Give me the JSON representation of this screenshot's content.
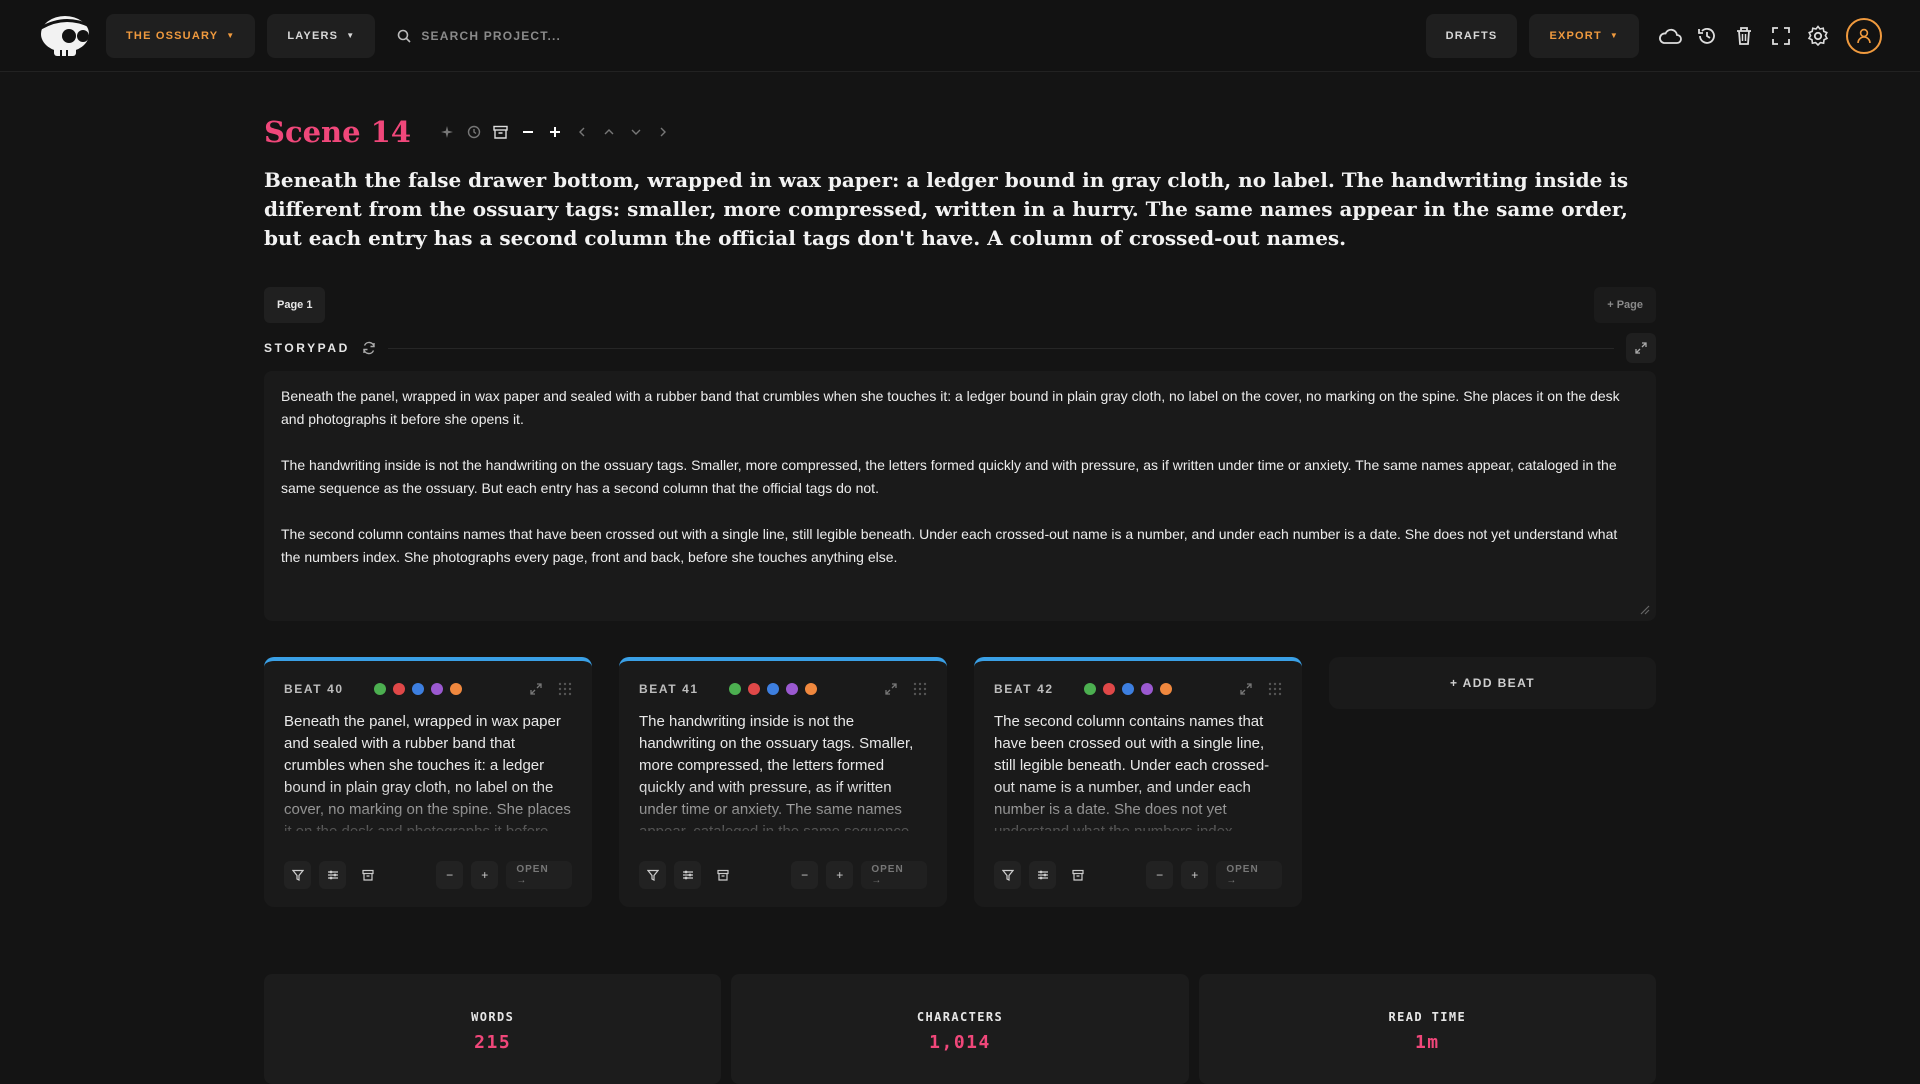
{
  "topbar": {
    "project_label": "THE OSSUARY",
    "layers_label": "LAYERS",
    "search_placeholder": "SEARCH PROJECT...",
    "drafts_label": "DRAFTS",
    "export_label": "EXPORT",
    "icons": [
      "cloud-icon",
      "history-icon",
      "trash-icon",
      "fullscreen-icon",
      "gear-icon",
      "user-icon"
    ],
    "accent": "#f09a3e"
  },
  "scene": {
    "title": "Scene 14",
    "title_color": "#f0477a",
    "summary": "Beneath the false drawer bottom, wrapped in wax paper: a ledger bound in gray cloth, no label. The handwriting inside is different from the ossuary tags: smaller, more compressed, written in a hurry. The same names appear in the same order, but each entry has a second column the official tags don't have. A column of crossed-out names."
  },
  "pages": {
    "current": "Page 1",
    "add_label": "+ Page"
  },
  "storypad": {
    "label": "STORYPAD",
    "paragraphs": [
      "Beneath the panel, wrapped in wax paper and sealed with a rubber band that crumbles when she touches it: a ledger bound in plain gray cloth, no label on the cover, no marking on the spine. She places it on the desk and photographs it before she opens it.",
      "The handwriting inside is not the handwriting on the ossuary tags. Smaller, more compressed, the letters formed quickly and with pressure, as if written under time or anxiety. The same names appear, cataloged in the same sequence as the ossuary. But each entry has a second column that the official tags do not.",
      "The second column contains names that have been crossed out with a single line, still legible beneath. Under each crossed-out name is a number, and under each number is a date. She does not yet understand what the numbers index. She photographs every page, front and back, before she touches anything else."
    ]
  },
  "beats": [
    {
      "label": "BEAT 40",
      "text": "Beneath the panel, wrapped in wax paper and sealed with a rubber band that crumbles when she touches it: a ledger bound in plain gray cloth, no label on the cover, no marking on the spine. She places it on the desk and photographs it before she opens it.",
      "open_label": "OPEN →"
    },
    {
      "label": "BEAT 41",
      "text": "The handwriting inside is not the handwriting on the ossuary tags. Smaller, more compressed, the letters formed quickly and with pressure, as if written under time or anxiety. The same names appear, cataloged in the same sequence as the ossuary.",
      "open_label": "OPEN →"
    },
    {
      "label": "BEAT 42",
      "text": "The second column contains names that have been crossed out with a single line, still legible beneath. Under each crossed-out name is a number, and under each number is a date. She does not yet understand what the numbers index.",
      "open_label": "OPEN →"
    }
  ],
  "beat_colors": [
    "#4caf50",
    "#e04848",
    "#3d7fe0",
    "#9b59d0",
    "#f0883e"
  ],
  "beat_accent": "#3aa0e6",
  "add_beat_label": "+ ADD BEAT",
  "stats": {
    "words_label": "WORDS",
    "words_value": "215",
    "chars_label": "CHARACTERS",
    "chars_value": "1,014",
    "read_label": "READ TIME",
    "read_value": "1m"
  }
}
